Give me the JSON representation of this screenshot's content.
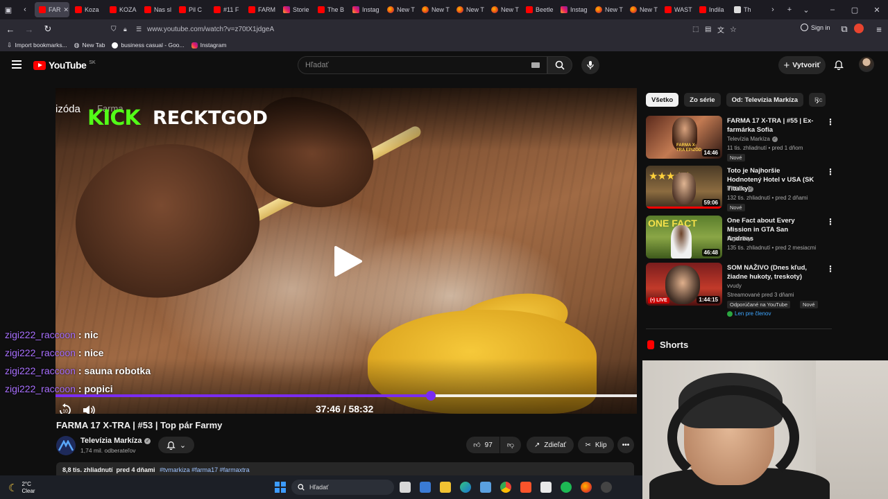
{
  "browser": {
    "tabs": [
      {
        "label": "FAR",
        "icon": "youtube-icon",
        "active": true
      },
      {
        "label": "Koza",
        "icon": "youtube-icon"
      },
      {
        "label": "KOZA",
        "icon": "youtube-icon"
      },
      {
        "label": "Nas sl",
        "icon": "youtube-icon"
      },
      {
        "label": "Pil C",
        "icon": "youtube-icon"
      },
      {
        "label": "#11 F",
        "icon": "youtube-icon"
      },
      {
        "label": "FARM",
        "icon": "youtube-icon"
      },
      {
        "label": "Storie",
        "icon": "instagram-icon"
      },
      {
        "label": "The B",
        "icon": "youtube-icon"
      },
      {
        "label": "Instag",
        "icon": "instagram-icon"
      },
      {
        "label": "New T",
        "icon": "firefox-icon"
      },
      {
        "label": "New T",
        "icon": "firefox-icon"
      },
      {
        "label": "New T",
        "icon": "firefox-icon"
      },
      {
        "label": "New T",
        "icon": "firefox-icon"
      },
      {
        "label": "Beetle",
        "icon": "youtube-icon"
      },
      {
        "label": "Instag",
        "icon": "instagram-icon"
      },
      {
        "label": "New T",
        "icon": "firefox-icon"
      },
      {
        "label": "New T",
        "icon": "firefox-icon"
      },
      {
        "label": "WAST",
        "icon": "youtube-icon"
      },
      {
        "label": "Indila",
        "icon": "youtube-icon"
      },
      {
        "label": "Th",
        "icon": "generic-icon"
      }
    ],
    "url": "www.youtube.com/watch?v=z70tX1jdgeA",
    "signin": "Sign in",
    "bookmarks": [
      {
        "label": "Import bookmarks...",
        "icon": "import-icon"
      },
      {
        "label": "New Tab",
        "icon": "globe-icon"
      },
      {
        "label": "business casual - Goo...",
        "icon": "google-icon"
      },
      {
        "label": "Instagram",
        "icon": "instagram-icon"
      }
    ]
  },
  "youtube": {
    "logo_text": "YouTube",
    "country": "SK",
    "search_placeholder": "Hľadať",
    "create_label": "Vytvoriť"
  },
  "video": {
    "overlay_episode": "izóda",
    "overlay_show": "Farma",
    "overlay_kick": "KICK",
    "overlay_streamer": "RECKTGOD",
    "time": "37:46 / 58:32",
    "progress": 0.645,
    "title": "FARMA 17 X-TRA | #53 | Top pár Farmy",
    "channel": "Televízia Markíza",
    "subscribers": "1,74 mil. odberateľov",
    "likes": "97",
    "share_label": "Zdieľať",
    "clip_label": "Klip",
    "views": "8,8 tis. zhliadnutí",
    "age": "pred 4 dňami",
    "tags": "#tvmarkiza #farma17 #farmaxtra"
  },
  "chat": [
    {
      "user": "zigi222_raccoon",
      "message": "nic"
    },
    {
      "user": "zigi222_raccoon",
      "message": "nice"
    },
    {
      "user": "zigi222_raccoon",
      "message": "sauna robotka"
    },
    {
      "user": "zigi222_raccoon",
      "message": "popici"
    }
  ],
  "sidebar": {
    "chips": [
      "Všetko",
      "Zo série",
      "Od: Televízia Markíza",
      "Pc"
    ],
    "recommendations": [
      {
        "title": "FARMA 17 X-TRA | #55 | Ex-farmárka Sofia",
        "channel": "Televízia Markíza",
        "meta": "11 tis. zhliadnutí • pred 1 dňom",
        "duration": "14:46",
        "badge": "Nové",
        "thumb_text": "FARMA X-TRA EPIZÓD"
      },
      {
        "title": "Toto je Najhoršie Hodnotený Hotel v USA (SK Titulky)",
        "channel": "PPPiter",
        "meta": "132 tis. zhliadnutí • pred 2 dňami",
        "duration": "59:06",
        "badge": "Nové"
      },
      {
        "title": "One Fact about Every Mission in GTA San Andreas",
        "channel": "Night Sky",
        "meta": "135 tis. zhliadnutí • pred 2 mesiacmi",
        "duration": "46:48",
        "thumb_text": "ONE FACT"
      },
      {
        "title": "SOM NAŽIVO (Dnes kľud, žiadne hukoty, treskoty)",
        "channel": "vvudy",
        "meta": "Streamované pred 3 dňami",
        "duration": "1:44:15",
        "live_label": "LIVE",
        "badge": "Odporúčané na YouTube",
        "badge2": "Nové",
        "members": "Len pre členov"
      }
    ],
    "shorts_label": "Shorts"
  },
  "taskbar": {
    "temp": "2°C",
    "weather": "Clear",
    "search": "Hľadať"
  },
  "colors": {
    "yt_red": "#ff0000",
    "progress": "#7a2cf0",
    "chat_user": "#a970ff",
    "kick_green": "#53fc18"
  }
}
